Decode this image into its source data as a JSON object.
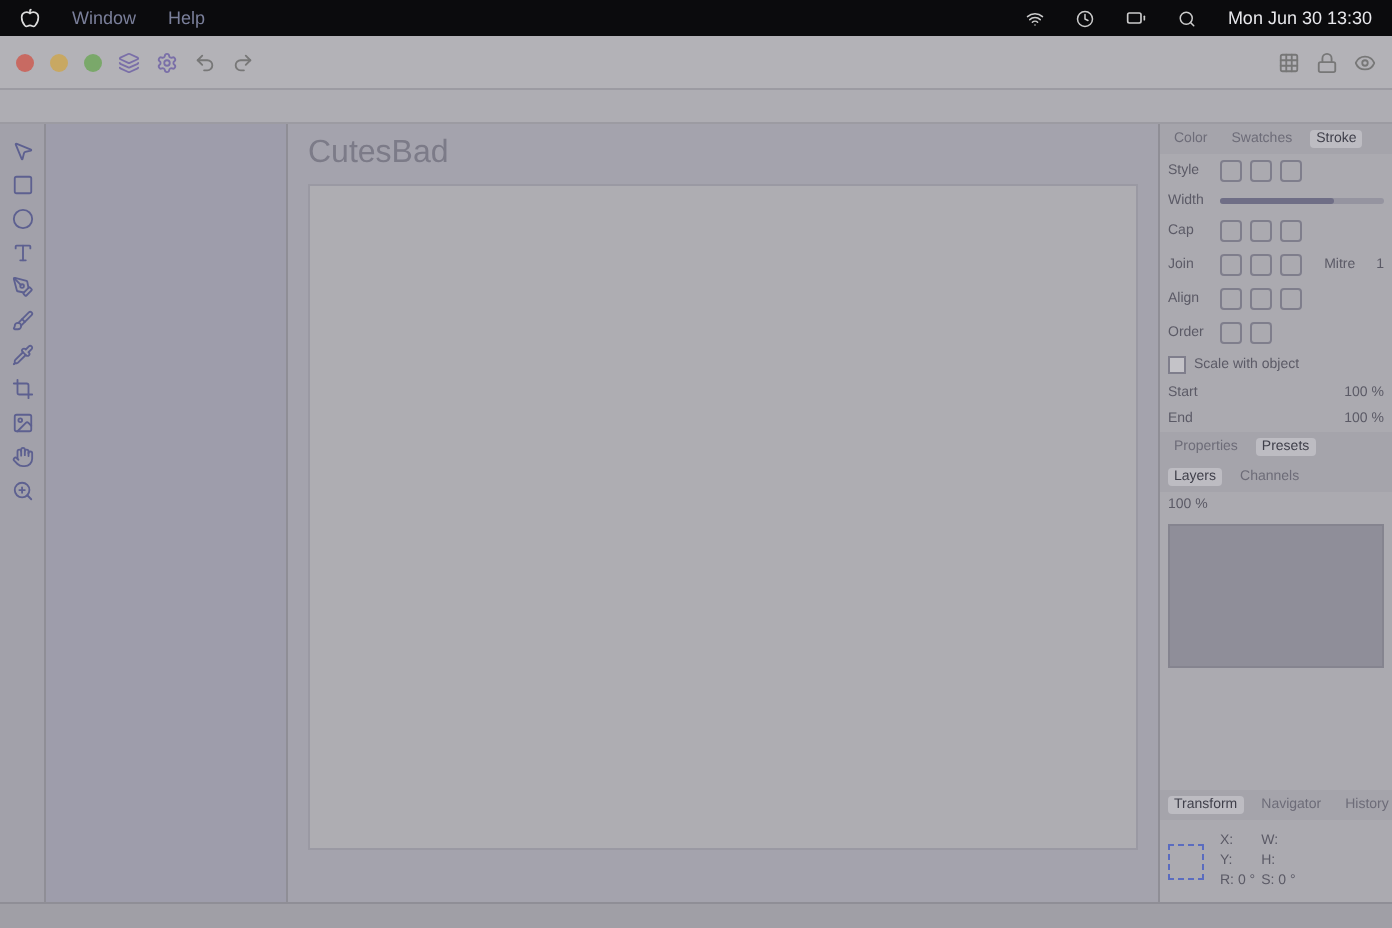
{
  "menu_bar": {
    "items": [
      "Window",
      "Help"
    ],
    "clock": "Mon Jun 30  13:30"
  },
  "document": {
    "title": "CutesBad"
  },
  "stroke_panel": {
    "tabs": [
      {
        "label": "Color",
        "selected": false
      },
      {
        "label": "Swatches",
        "selected": false
      },
      {
        "label": "Stroke",
        "selected": true
      }
    ],
    "rows": [
      {
        "label": "Style",
        "kind": "icons"
      },
      {
        "label": "Width",
        "kind": "slider",
        "level": 0.7
      },
      {
        "label": "Cap",
        "kind": "icons"
      },
      {
        "label": "Join",
        "kind": "icons"
      },
      {
        "label": "Align",
        "kind": "icons"
      },
      {
        "label": "Order",
        "kind": "icons"
      }
    ],
    "mitre": {
      "label": "Mitre",
      "value": "1"
    },
    "scale_with_object": {
      "label": "Scale with object",
      "checked": false
    },
    "arrows": [
      {
        "label": "Start",
        "value": "100 %"
      },
      {
        "label": "End",
        "value": "100 %"
      }
    ]
  },
  "mid_tabs": [
    {
      "label": "Properties",
      "selected": false
    },
    {
      "label": "Presets",
      "selected": true
    }
  ],
  "layers_panel": {
    "tabs": [
      {
        "label": "Layers",
        "selected": true
      },
      {
        "label": "Channels",
        "selected": false
      }
    ],
    "opacity": "100 %"
  },
  "transform_panel": {
    "tabs": [
      {
        "label": "Transform",
        "selected": true
      },
      {
        "label": "Navigator",
        "selected": false
      },
      {
        "label": "History",
        "selected": false
      }
    ],
    "fields": [
      {
        "label": "X:"
      },
      {
        "label": "W:"
      },
      {
        "label": "Y:"
      },
      {
        "label": "H:"
      },
      {
        "label": "R:",
        "value": "0 °"
      },
      {
        "label": "S:",
        "value": "0 °"
      }
    ]
  }
}
